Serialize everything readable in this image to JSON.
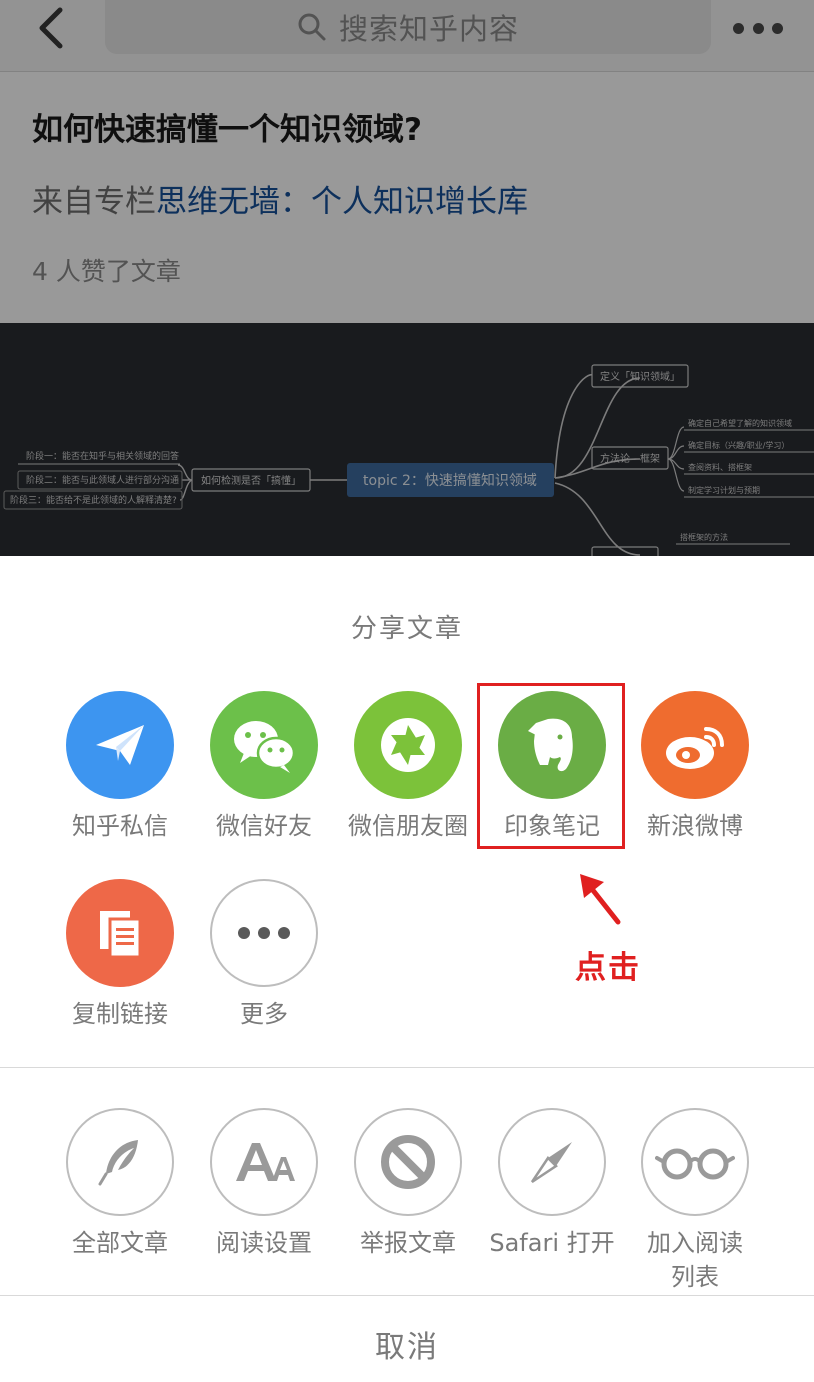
{
  "navbar": {
    "search_placeholder": "搜索知乎内容"
  },
  "article": {
    "title": "如何快速搞懂一个知识领域?",
    "column_prefix": "来自专栏",
    "column_name": "思维无墙：个人知识增长库",
    "likes": "4 人赞了文章"
  },
  "mindmap": {
    "center": "topic 2：快速搞懂知识领域",
    "left_branch": "如何检测是否「搞懂」",
    "left_leaves": [
      "阶段一：能否在知乎与相关领域的回答",
      "阶段二：能否与此领域人进行部分沟通",
      "阶段三：能否给不是此领域的人解释清楚?"
    ],
    "right_top": "定义「知识领域」",
    "right_mid": "方法论 - 框架",
    "right_leaves": [
      "确定自己希望了解的知识领域",
      "确定目标（兴趣/职业/学习）",
      "查阅资料、搭框架",
      "制定学习计划与预期"
    ],
    "right_bottom_leaf": "搭框架的方法"
  },
  "share": {
    "title": "分享文章",
    "row1": [
      {
        "label": "知乎私信",
        "icon": "paper-plane-icon",
        "color": "#3d95f0"
      },
      {
        "label": "微信好友",
        "icon": "wechat-icon",
        "color": "#6cc04a"
      },
      {
        "label": "微信朋友圈",
        "icon": "aperture-icon",
        "color": "#7cc23a"
      },
      {
        "label": "印象笔记",
        "icon": "evernote-elephant-icon",
        "color": "#6aad45"
      },
      {
        "label": "新浪微博",
        "icon": "weibo-icon",
        "color": "#ef6c2f"
      }
    ],
    "row2": [
      {
        "label": "复制链接",
        "icon": "copy-document-icon",
        "color": "#ee6848"
      },
      {
        "label": "更多",
        "icon": "more-dots-icon",
        "color": "#ffffff"
      }
    ],
    "actions": [
      {
        "label": "全部文章",
        "icon": "feather-icon"
      },
      {
        "label": "阅读设置",
        "icon": "font-size-icon"
      },
      {
        "label": "举报文章",
        "icon": "no-entry-icon"
      },
      {
        "label": "Safari 打开",
        "icon": "compass-icon"
      },
      {
        "label": "加入阅读列表",
        "label_line1": "加入阅读",
        "label_line2": "列表",
        "icon": "glasses-icon"
      }
    ],
    "cancel": "取消"
  },
  "annotation": {
    "text": "点击",
    "color": "#e02020"
  }
}
